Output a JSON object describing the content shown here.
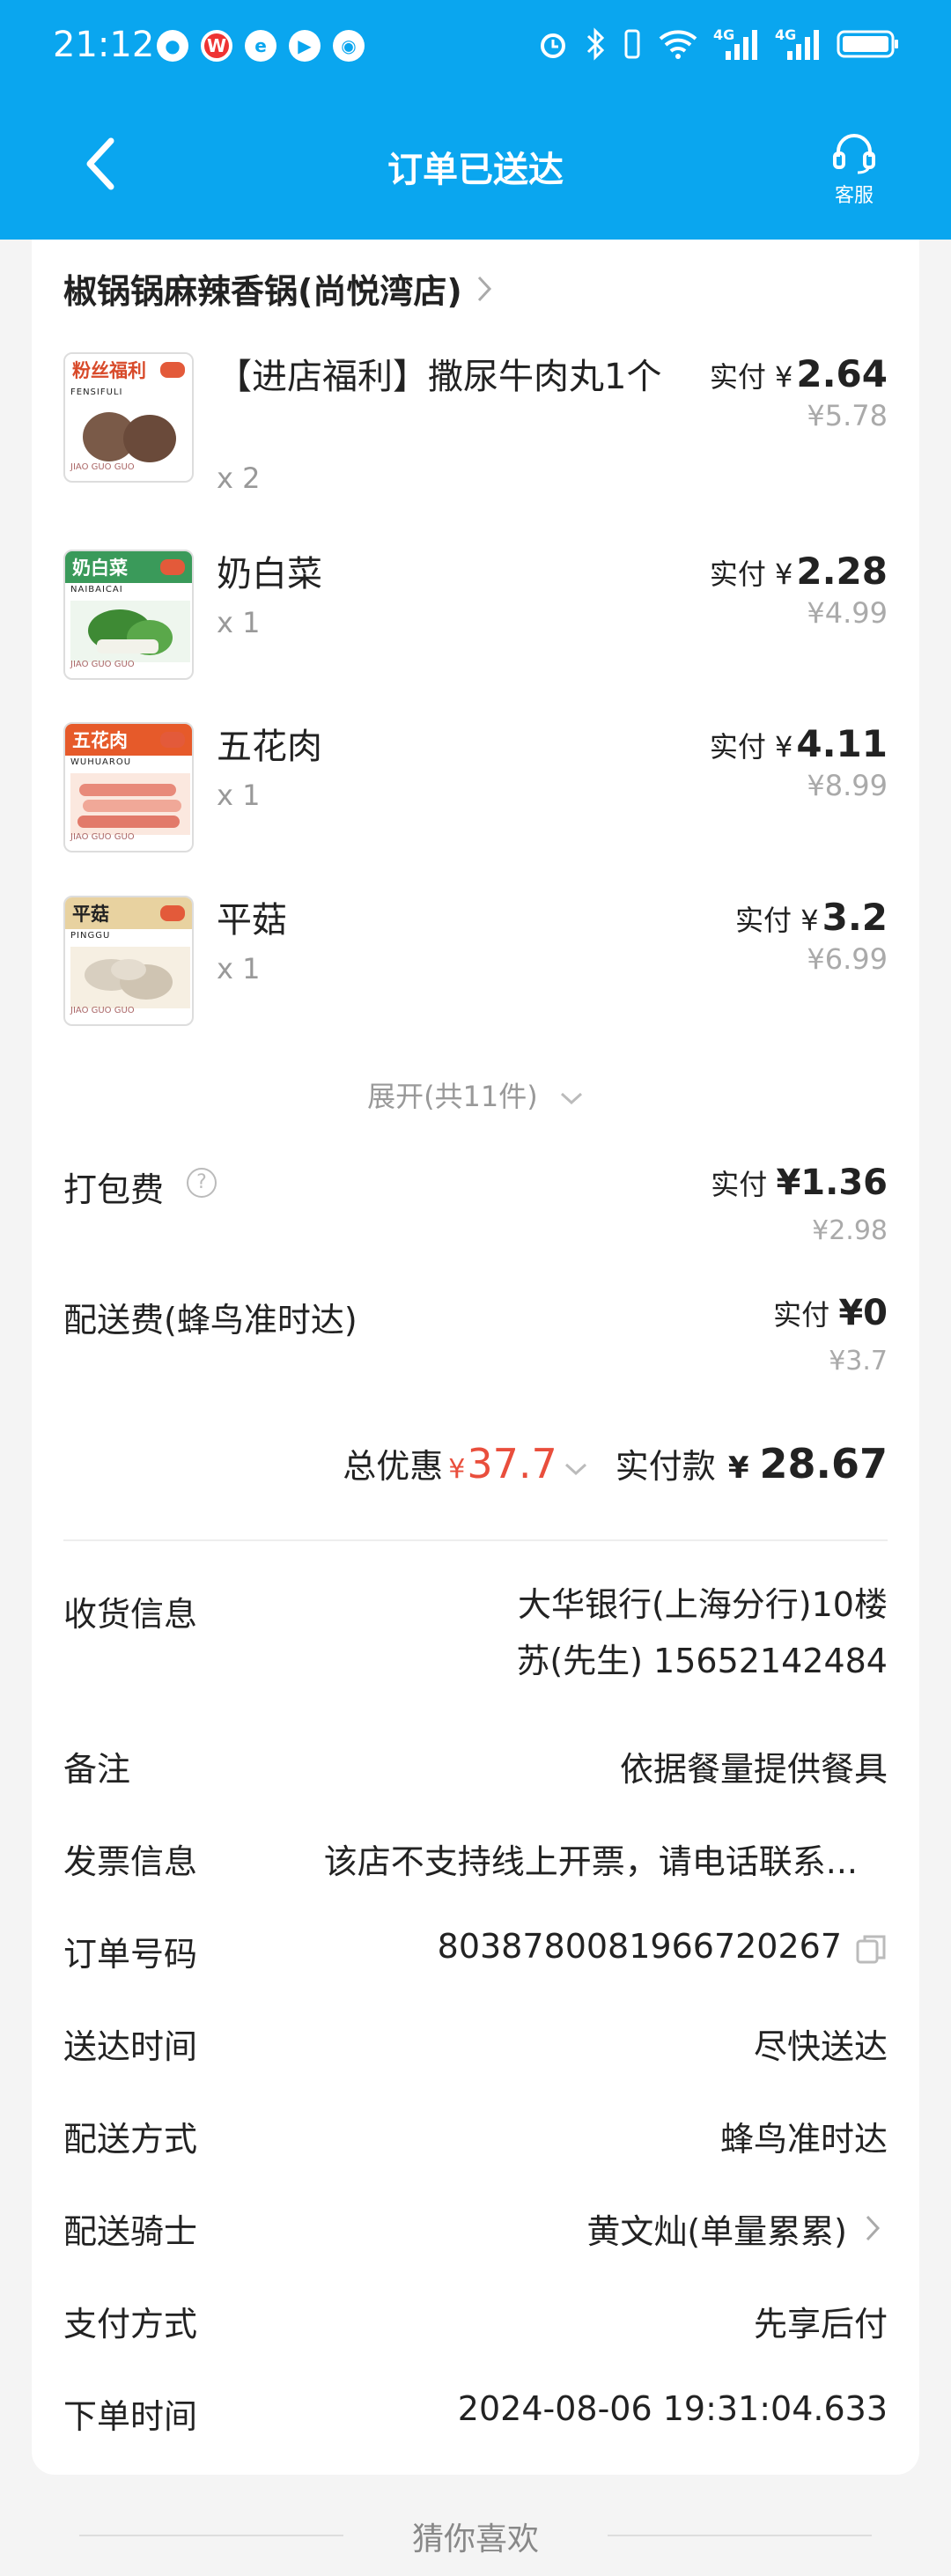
{
  "status_bar": {
    "time": "21:12",
    "net_label_1": "4G",
    "net_label_2": "4G"
  },
  "header": {
    "title": "订单已送达",
    "service_label": "客服"
  },
  "store": {
    "name": "椒锅锅麻辣香锅(尚悦湾店)"
  },
  "items": [
    {
      "thumb_title": "粉丝福利",
      "thumb_pinyin": "FENSIFULI",
      "name": "【进店福利】撒尿牛肉丸1个",
      "qty": "x 2",
      "paid_label": "实付",
      "currency": "¥",
      "paid": "2.64",
      "original": "¥5.78",
      "thumb_color": "#ffffff",
      "thumb_title_color": "#d84a2a"
    },
    {
      "thumb_title": "奶白菜",
      "thumb_pinyin": "NAIBAICAI",
      "name": "奶白菜",
      "qty": "x 1",
      "paid_label": "实付",
      "currency": "¥",
      "paid": "2.28",
      "original": "¥4.99",
      "thumb_color": "#3a9a5a",
      "thumb_title_color": "#ffffff"
    },
    {
      "thumb_title": "五花肉",
      "thumb_pinyin": "WUHUAROU",
      "name": "五花肉",
      "qty": "x 1",
      "paid_label": "实付",
      "currency": "¥",
      "paid": "4.11",
      "original": "¥8.99",
      "thumb_color": "#e65a2a",
      "thumb_title_color": "#ffffff"
    },
    {
      "thumb_title": "平菇",
      "thumb_pinyin": "PINGGU",
      "name": "平菇",
      "qty": "x 1",
      "paid_label": "实付",
      "currency": "¥",
      "paid": "3.2",
      "original": "¥6.99",
      "thumb_color": "#e8d2a0",
      "thumb_title_color": "#222222"
    }
  ],
  "thumb_footer": "JIAO GUO GUO",
  "expand_label": "展开(共11件)",
  "fees": {
    "packing": {
      "label": "打包费",
      "paid_label": "实付",
      "paid": "¥1.36",
      "original": "¥2.98"
    },
    "delivery": {
      "label": "配送费(蜂鸟准时达)",
      "paid_label": "实付",
      "paid": "¥0",
      "original": "¥3.7"
    }
  },
  "totals": {
    "discount_label": "总优惠",
    "discount_currency": "¥",
    "discount_amount": "37.7",
    "paid_label": "实付款",
    "paid_currency": "¥",
    "paid_amount": "28.67"
  },
  "info": {
    "receiver": {
      "label": "收货信息",
      "address": "大华银行(上海分行)10楼",
      "contact": "苏(先生) 15652142484"
    },
    "remark": {
      "label": "备注",
      "value": "依据餐量提供餐具"
    },
    "invoice": {
      "label": "发票信息",
      "value": "该店不支持线上开票，请电话联系..."
    },
    "order_no": {
      "label": "订单号码",
      "value": "8038780081966720267"
    },
    "delivery_time": {
      "label": "送达时间",
      "value": "尽快送达"
    },
    "delivery_method": {
      "label": "配送方式",
      "value": "蜂鸟准时达"
    },
    "rider": {
      "label": "配送骑士",
      "value": "黄文灿(单量累累)"
    },
    "payment": {
      "label": "支付方式",
      "value": "先享后付"
    },
    "order_time": {
      "label": "下单时间",
      "value": "2024-08-06 19:31:04.633"
    }
  },
  "recommend_title": "猜你喜欢",
  "colors": {
    "header_bg": "#0aa6ef",
    "discount_red": "#e94e3c"
  }
}
